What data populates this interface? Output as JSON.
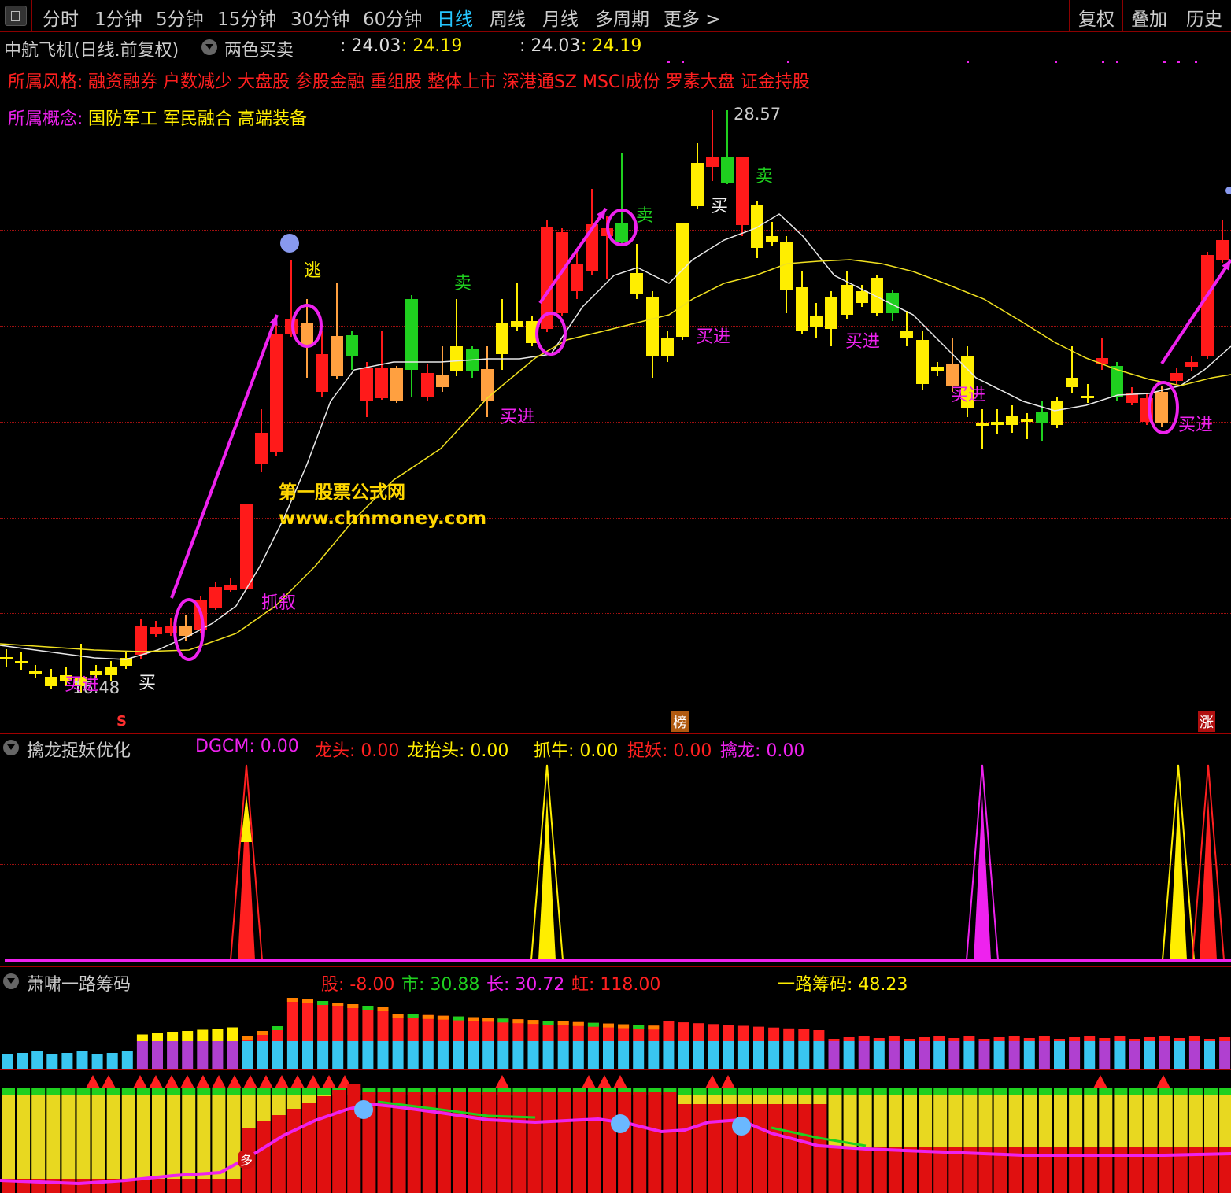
{
  "topbar": {
    "tabs": [
      {
        "label": "分时",
        "active": false
      },
      {
        "label": "1分钟",
        "active": false
      },
      {
        "label": "5分钟",
        "active": false
      },
      {
        "label": "15分钟",
        "active": false
      },
      {
        "label": "30分钟",
        "active": false
      },
      {
        "label": "60分钟",
        "active": false
      },
      {
        "label": "日线",
        "active": true
      },
      {
        "label": "周线",
        "active": false
      },
      {
        "label": "月线",
        "active": false
      },
      {
        "label": "多周期",
        "active": false
      },
      {
        "label": "更多 >",
        "active": false
      }
    ],
    "right_buttons": [
      "复权",
      "叠加",
      "历史"
    ]
  },
  "main_panel": {
    "title": "中航飞机(日线.前复权)",
    "indicator": "两色买卖",
    "value1_label": ": 24.03",
    "value1": ": 24.19",
    "value2_label": ": 24.03",
    "value2": ": 24.19",
    "style_label": "所属风格:",
    "style_values": "融资融券 户数减少 大盘股 参股金融 重组股 整体上市 深港通SZ MSCI成份 罗素大盘 证金持股",
    "concept_label": "所属概念:",
    "concept_values": "国防军工 军民融合 高端装备",
    "high_price": "28.57",
    "low_price": "16.48",
    "watermark_line1": "第一股票公式网",
    "watermark_line2": "www.chnmoney.com",
    "signals": {
      "buy": "买",
      "buy_in": "买进",
      "sell": "卖",
      "escape": "逃",
      "grab_fork": "抓叙"
    },
    "bottom_tags": {
      "s": "S",
      "bang": "榜",
      "zhang": "涨"
    },
    "colors": {
      "up": "#ff1a1a",
      "down": "#ffee00",
      "green": "#1fd01f",
      "orange": "#ffa040",
      "magenta": "#ee22ee",
      "ma_white": "#e8e8e8",
      "ma_yellow": "#f0e020"
    }
  },
  "panel2": {
    "title": "擒龙捉妖优化",
    "items": [
      {
        "label": "DGCM:",
        "value": "0.00",
        "color": "#ee22ee"
      },
      {
        "label": "龙头:",
        "value": "0.00",
        "color": "#ff2020"
      },
      {
        "label": "龙抬头:",
        "value": "0.00",
        "color": "#ffee00"
      },
      {
        "label": "抓牛:",
        "value": "0.00",
        "color": "#ffee00"
      },
      {
        "label": "捉妖:",
        "value": "0.00",
        "color": "#ff2020"
      },
      {
        "label": "擒龙:",
        "value": "0.00",
        "color": "#ee22ee"
      }
    ]
  },
  "panel3": {
    "title": "萧啸一路筹码",
    "items": [
      {
        "label": "股:",
        "value": "-8.00",
        "color": "#ff2020"
      },
      {
        "label": "市:",
        "value": "30.88",
        "color": "#1fd01f"
      },
      {
        "label": "长:",
        "value": "30.72",
        "color": "#ee22ee"
      },
      {
        "label": "虹:",
        "value": "118.00",
        "color": "#ff2020"
      },
      {
        "label": "一路筹码:",
        "value": "48.23",
        "color": "#ffee00"
      }
    ],
    "tag_duo": "多"
  }
}
